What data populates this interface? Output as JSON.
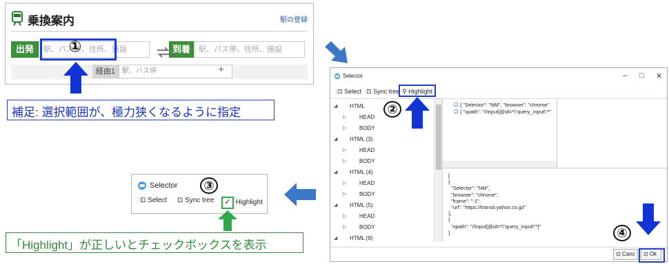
{
  "transit": {
    "title": "乗換案内",
    "register_link": "駅の登録",
    "depart_label": "出発",
    "depart_placeholder": "駅、バス停、住所、施設",
    "arrive_label": "到着",
    "arrive_placeholder": "駅、バス停、住所、施設",
    "via_label": "経由1",
    "via_placeholder": "駅、バス停",
    "add_via": "+"
  },
  "markers": [
    "①",
    "②",
    "③",
    "④"
  ],
  "notes": {
    "note1": "補足: 選択範囲が、極力狭くなるように指定",
    "note2": "「Highlight」が正しいとチェックボックスを表示"
  },
  "selector": {
    "title": "Selector",
    "toolbar": {
      "select": "Select",
      "sync_tree": "Sync tree",
      "highlight": "Highlight"
    },
    "window_buttons": {
      "minimize": "–",
      "maximize": "□",
      "close": "✕"
    },
    "tree": [
      {
        "label": "HTML",
        "expanded": true,
        "indent": 0
      },
      {
        "label": "HEAD",
        "expanded": false,
        "indent": 1
      },
      {
        "label": "BODY",
        "expanded": false,
        "indent": 1
      },
      {
        "label": "HTML (3)",
        "expanded": true,
        "indent": 0
      },
      {
        "label": "HEAD",
        "expanded": false,
        "indent": 1
      },
      {
        "label": "BODY",
        "expanded": false,
        "indent": 1
      },
      {
        "label": "HTML (4)",
        "expanded": true,
        "indent": 0
      },
      {
        "label": "HEAD",
        "expanded": false,
        "indent": 1
      },
      {
        "label": "BODY",
        "expanded": false,
        "indent": 1
      },
      {
        "label": "HTML (5)",
        "expanded": true,
        "indent": 0
      },
      {
        "label": "HEAD",
        "expanded": false,
        "indent": 1
      },
      {
        "label": "BODY",
        "expanded": false,
        "indent": 1
      },
      {
        "label": "HTML (9)",
        "expanded": true,
        "indent": 0
      }
    ],
    "attributes": [
      "{  \"Selector\": \"NM\",   \"browser\": \"chrome\"",
      "{  \"xpath\": \"//input[@id=*\\\"query_input\\\"*\""
    ],
    "code_lines": [
      "[",
      "{",
      "  \"Selector\": \"NM\",",
      "  \"browser\": \"chrome\",",
      "  \"frame\": \"-1\",",
      "  \"url\": \"https://transit.yahoo.co.jp/\"",
      "},",
      "{",
      "  \"xpath\": \"//input[@id=*\\\"query_input\\\"*]\"",
      "}"
    ],
    "cancel_label": "Canc",
    "ok_label": "Ok"
  },
  "mini_selector": {
    "title": "Selector",
    "select": "Select",
    "sync_tree": "Sync tree",
    "highlight": "Highlight"
  },
  "colors": {
    "green": "#3d8f3a",
    "highlight_blue": "#1e3cc8",
    "arrow_blue": "#1233d6",
    "arrow_light_blue": "#3b78c9",
    "arrow_green": "#2fa84a"
  }
}
